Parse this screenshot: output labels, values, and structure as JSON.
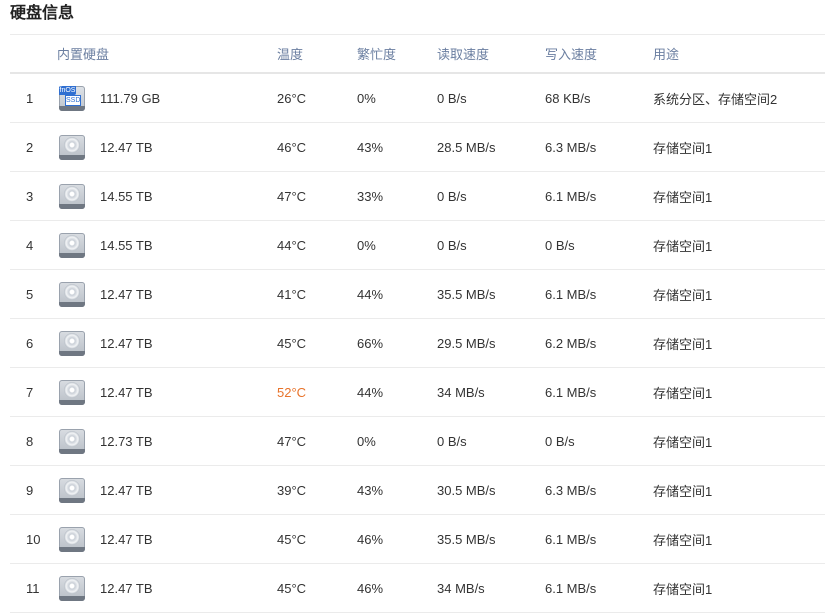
{
  "page_title": "硬盘信息",
  "columns": {
    "disk": "内置硬盘",
    "temp": "温度",
    "busy": "繁忙度",
    "read": "读取速度",
    "write": "写入速度",
    "use": "用途"
  },
  "accent_colors": {
    "hot_temperature": "#e8732a",
    "header_text": "#6a7ea0"
  },
  "rows": [
    {
      "index": "1",
      "icon": "ssd-icon",
      "icon_brand": "fnOS",
      "icon_tag": "SSD",
      "capacity": "111.79 GB",
      "temp": "26°C",
      "busy": "0%",
      "read": "0 B/s",
      "write": "68 KB/s",
      "use": "系统分区、存储空间2",
      "hot": false
    },
    {
      "index": "2",
      "icon": "hdd-icon",
      "capacity": "12.47 TB",
      "temp": "46°C",
      "busy": "43%",
      "read": "28.5 MB/s",
      "write": "6.3 MB/s",
      "use": "存储空间1",
      "hot": false
    },
    {
      "index": "3",
      "icon": "hdd-icon",
      "capacity": "14.55 TB",
      "temp": "47°C",
      "busy": "33%",
      "read": "0 B/s",
      "write": "6.1 MB/s",
      "use": "存储空间1",
      "hot": false
    },
    {
      "index": "4",
      "icon": "hdd-icon",
      "capacity": "14.55 TB",
      "temp": "44°C",
      "busy": "0%",
      "read": "0 B/s",
      "write": "0 B/s",
      "use": "存储空间1",
      "hot": false
    },
    {
      "index": "5",
      "icon": "hdd-icon",
      "capacity": "12.47 TB",
      "temp": "41°C",
      "busy": "44%",
      "read": "35.5 MB/s",
      "write": "6.1 MB/s",
      "use": "存储空间1",
      "hot": false
    },
    {
      "index": "6",
      "icon": "hdd-icon",
      "capacity": "12.47 TB",
      "temp": "45°C",
      "busy": "66%",
      "read": "29.5 MB/s",
      "write": "6.2 MB/s",
      "use": "存储空间1",
      "hot": false
    },
    {
      "index": "7",
      "icon": "hdd-icon",
      "capacity": "12.47 TB",
      "temp": "52°C",
      "busy": "44%",
      "read": "34 MB/s",
      "write": "6.1 MB/s",
      "use": "存储空间1",
      "hot": true
    },
    {
      "index": "8",
      "icon": "hdd-icon",
      "capacity": "12.73 TB",
      "temp": "47°C",
      "busy": "0%",
      "read": "0 B/s",
      "write": "0 B/s",
      "use": "存储空间1",
      "hot": false
    },
    {
      "index": "9",
      "icon": "hdd-icon",
      "capacity": "12.47 TB",
      "temp": "39°C",
      "busy": "43%",
      "read": "30.5 MB/s",
      "write": "6.3 MB/s",
      "use": "存储空间1",
      "hot": false
    },
    {
      "index": "10",
      "icon": "hdd-icon",
      "capacity": "12.47 TB",
      "temp": "45°C",
      "busy": "46%",
      "read": "35.5 MB/s",
      "write": "6.1 MB/s",
      "use": "存储空间1",
      "hot": false
    },
    {
      "index": "11",
      "icon": "hdd-icon",
      "capacity": "12.47 TB",
      "temp": "45°C",
      "busy": "46%",
      "read": "34 MB/s",
      "write": "6.1 MB/s",
      "use": "存储空间1",
      "hot": false
    }
  ]
}
